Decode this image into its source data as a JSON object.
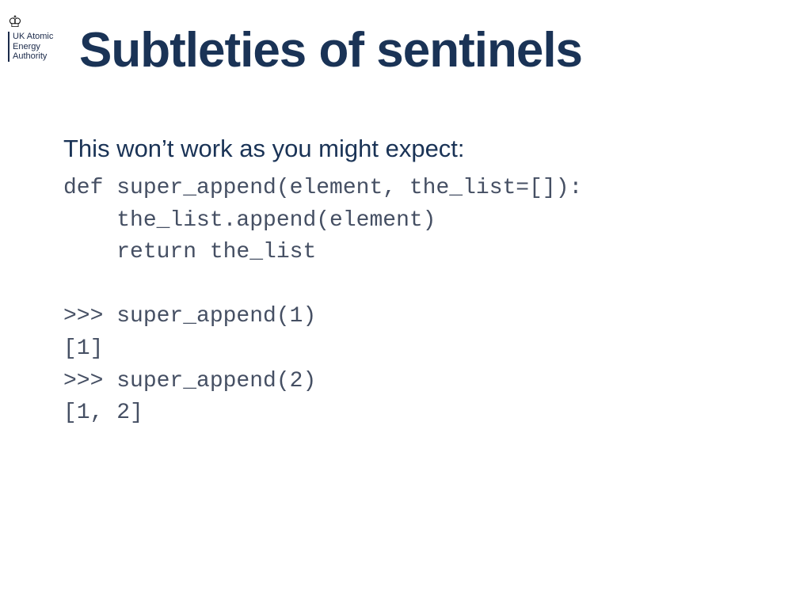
{
  "logo": {
    "line1": "UK Atomic",
    "line2": "Energy",
    "line3": "Authority"
  },
  "title": "Subtleties of sentinels",
  "lead": "This won’t work as you might expect:",
  "code": "def super_append(element, the_list=[]):\n    the_list.append(element)\n    return the_list\n\n>>> super_append(1)\n[1]\n>>> super_append(2)\n[1, 2]"
}
